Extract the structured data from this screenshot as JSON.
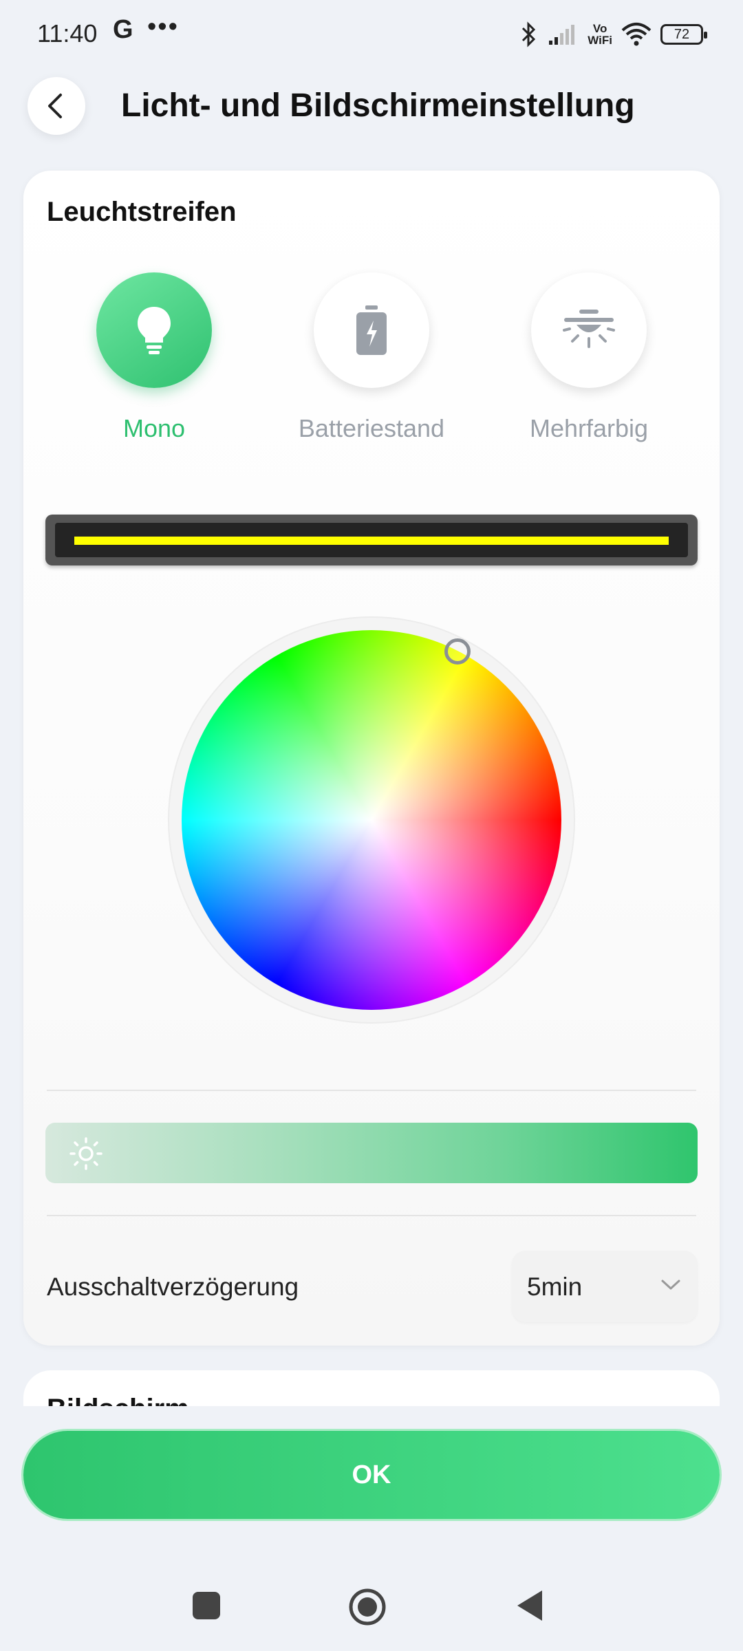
{
  "status_bar": {
    "time": "11:40",
    "google_icon": "G",
    "more_dots": "•••",
    "vowifi_top": "Vo",
    "vowifi_bottom": "WiFi",
    "battery_level": "72"
  },
  "header": {
    "title": "Licht- und Bildschirmeinstellung"
  },
  "light_strip_section": {
    "title": "Leuchtstreifen",
    "modes": [
      {
        "label": "Mono",
        "icon": "bulb-icon",
        "active": true
      },
      {
        "label": "Batteriestand",
        "icon": "battery-charge-icon",
        "active": false
      },
      {
        "label": "Mehrfarbig",
        "icon": "ceiling-lamp-icon",
        "active": false
      }
    ],
    "strip_color": "#ffff00",
    "brightness_level_percent": 100,
    "delay": {
      "label": "Ausschaltverzögerung",
      "value": "5min"
    }
  },
  "screen_section": {
    "title": "Bildschirm"
  },
  "footer": {
    "ok_label": "OK"
  },
  "colors": {
    "accent": "#2ec56e",
    "background": "#eff2f7"
  }
}
